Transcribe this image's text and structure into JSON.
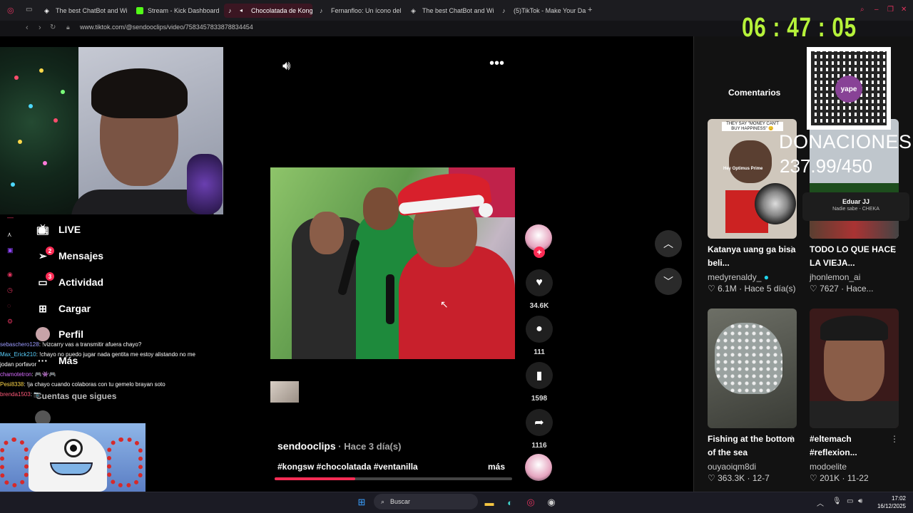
{
  "browser": {
    "tabs": [
      {
        "label": "The best ChatBot and Wi",
        "active": false,
        "icon": "chatbot-icon"
      },
      {
        "label": "Stream - Kick Dashboard",
        "active": false,
        "icon": "kick-icon"
      },
      {
        "label": "Chocolatada de Kong",
        "active": true,
        "icon": "tiktok-icon"
      },
      {
        "label": "Fernanfloo: Un ícono del",
        "active": false,
        "icon": "tiktok-icon"
      },
      {
        "label": "The best ChatBot and Wi",
        "active": false,
        "icon": "chatbot-icon"
      },
      {
        "label": "(5)TikTok - Make Your Da",
        "active": false,
        "icon": "tiktok-icon"
      }
    ],
    "new_tab": "+",
    "url": "www.tiktok.com/@sendooclips/video/7583457833878834454"
  },
  "overlay": {
    "clock": "06 : 47 : 05",
    "donations_label": "DONACIONES",
    "donations_value": "237.99/450",
    "qr_brand": "yape",
    "popup_name": "Eduar JJ",
    "popup_sub": "Nadie sabe - CHEKA"
  },
  "tiktok_nav": {
    "items": [
      {
        "label": "LIVE",
        "icon": "live-tv-icon"
      },
      {
        "label": "Mensajes",
        "icon": "messages-icon",
        "badge": "2"
      },
      {
        "label": "Actividad",
        "icon": "activity-icon",
        "badge": "3"
      },
      {
        "label": "Cargar",
        "icon": "upload-icon"
      },
      {
        "label": "Perfil",
        "icon": "profile-avatar-icon"
      },
      {
        "label": "Más",
        "icon": "more-icon"
      }
    ],
    "following_header": "Cuentas que sigues"
  },
  "chat": [
    {
      "user": "sebaschero128",
      "color": "#9b9bff",
      "text": ": !vizcarry vas a transmitir afuera chayo?"
    },
    {
      "user": "Max_Erick210",
      "color": "#5ad1ff",
      "text": ": !chayo no puedo jugar nada gentita me estoy alistando no me"
    },
    {
      "user": "",
      "color": "#ffffff",
      "text": "jodan porfavor"
    },
    {
      "user": "chamotetron",
      "color": "#d66bff",
      "text": ": 🎮👾🎮"
    },
    {
      "user": "Pesi8338",
      "color": "#ffd84a",
      "text": ": !ja chayo cuando colaboras con tu gemelo brayan soto"
    },
    {
      "user": "brenda1503",
      "color": "#ff5a7a",
      "text": ": 📷"
    }
  ],
  "video": {
    "author": "sendooclips",
    "time": " · Hace 3 día(s)",
    "hashtags": "#kongsw #chocolatada #ventanilla",
    "more": "más",
    "progress": 0.34
  },
  "actions": {
    "likes": "34.6K",
    "comments": "111",
    "saves": "1598",
    "shares": "1116"
  },
  "side_panel": {
    "title": "Comentarios",
    "cards": [
      {
        "title": "Katanya uang ga bisa beli...",
        "author": "medyrenaldy_",
        "verified": true,
        "views": "6.1M",
        "time": "Hace 5 día(s)",
        "img_text": "THEY SAY \"MONEY CAN'T BUY HAPPINESS\" 😊",
        "img_caption": "Hey Optimus Prime"
      },
      {
        "title": "TODO LO QUE HACE LA VIEJA...",
        "author": "jhonlemon_ai",
        "verified": false,
        "views": "7627",
        "time": "Hace...",
        "img_text": "",
        "img_caption": ""
      },
      {
        "title": "Fishing at the bottom of the sea",
        "author": "ouyaoiqm8di",
        "verified": false,
        "views": "363.3K",
        "time": "12-7",
        "img_text": "",
        "img_caption": ""
      },
      {
        "title": "#eltemach #reflexion...",
        "author": "modoelite",
        "verified": false,
        "views": "201K",
        "time": "11-22",
        "img_text": "",
        "img_caption": ""
      }
    ]
  },
  "taskbar": {
    "search_placeholder": "Buscar",
    "time": "17:02",
    "date": "16/12/2025"
  }
}
